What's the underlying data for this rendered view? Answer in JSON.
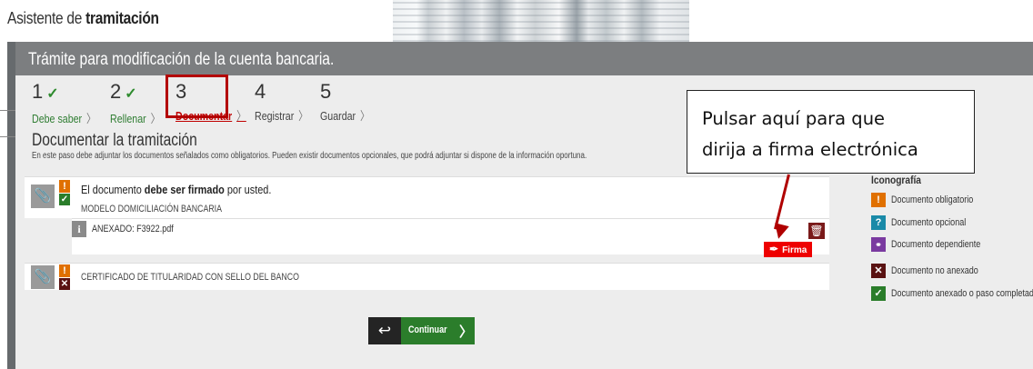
{
  "header": {
    "title_prefix": "Asistente de ",
    "title_bold": "tramitación"
  },
  "panel": {
    "title": "Trámite para modificación de la cuenta bancaria."
  },
  "steps": [
    {
      "num": "1",
      "check": "✓",
      "label": "Debe saber",
      "sep": "〉"
    },
    {
      "num": "2",
      "check": "✓",
      "label": "Rellenar",
      "sep": "〉"
    },
    {
      "num": "3",
      "check": "",
      "label": "Documentar",
      "sep": "〉"
    },
    {
      "num": "4",
      "check": "",
      "label": "Registrar",
      "sep": "〉"
    },
    {
      "num": "5",
      "check": "",
      "label": "Guardar",
      "sep": "〉"
    }
  ],
  "section": {
    "title": "Documentar la tramitación",
    "description": "En este paso debe adjuntar los documentos señalados como obligatorios. Pueden existir documentos opcionales, que podrá adjuntar si dispone de la información oportuna."
  },
  "doc1": {
    "msg_prefix": "El documento ",
    "msg_bold": "debe ser firmado",
    "msg_suffix": " por usted.",
    "name": "MODELO DOMICILIACIÓN BANCARIA",
    "annex": "ANEXADO: F3922.pdf",
    "sign_label": "Firma",
    "status_top": "!",
    "status_bottom": "✓"
  },
  "doc2": {
    "name": "CERTIFICADO DE TITULARIDAD CON SELLO DEL BANCO",
    "status_top": "!",
    "status_bottom": "✕"
  },
  "callout": {
    "line1": "Pulsar aquí para que",
    "line2": "dirija a firma electrónica"
  },
  "legend": {
    "title": "Iconografía",
    "items": [
      {
        "icon": "!",
        "label": "Documento obligatorio",
        "color": "#e07000"
      },
      {
        "icon": "?",
        "label": "Documento opcional",
        "color": "#1a8aa8"
      },
      {
        "icon": "🔗",
        "label": "Documento dependiente",
        "color": "#7a3aa0"
      },
      {
        "icon": "✕",
        "label": "Documento no anexado",
        "color": "#5a1212"
      },
      {
        "icon": "✓",
        "label": "Documento anexado o paso completado",
        "color": "#2a7d2a"
      }
    ]
  },
  "actions": {
    "back_icon": "↩",
    "continue_label": "Continuar",
    "continue_arrow": "〉"
  },
  "colors": {
    "header_gray": "#7c7e80",
    "accent_red": "#ee0000",
    "continue_green": "#2b7d2b"
  }
}
